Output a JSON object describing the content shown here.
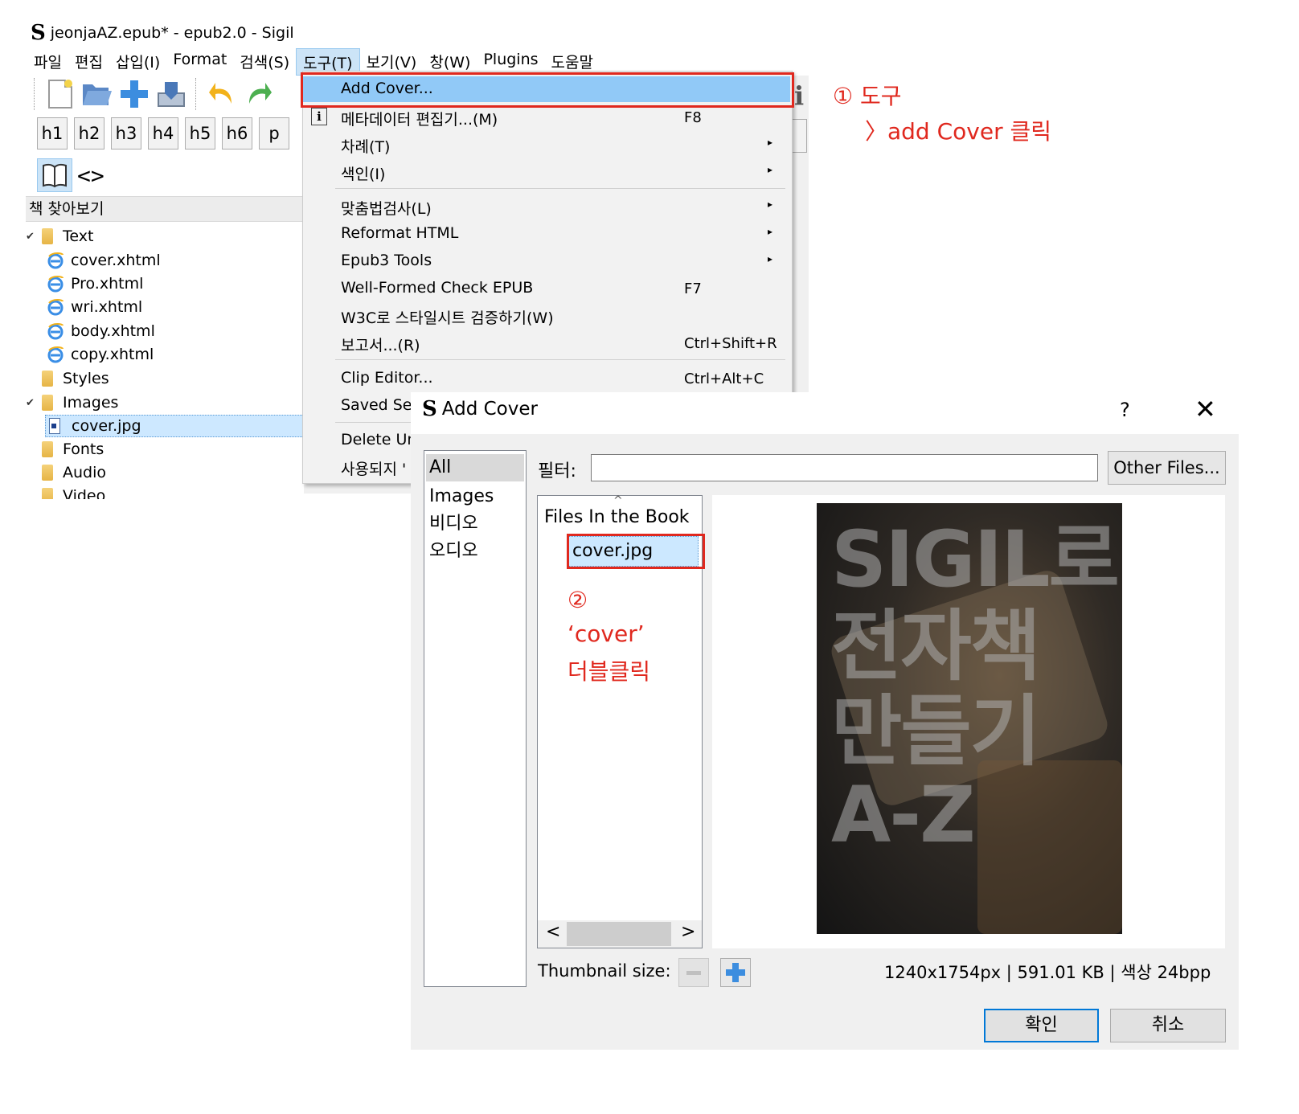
{
  "window": {
    "title": "jeonjaAZ.epub* - epub2.0 - Sigil",
    "logo": "S",
    "logo_icon": "sigil-logo-icon"
  },
  "menubar": [
    "파일",
    "편집",
    "삽입(I)",
    "Format",
    "검색(S)",
    "도구(T)",
    "보기(V)",
    "창(W)",
    "Plugins",
    "도움말"
  ],
  "toolbar": {
    "icons": [
      "new-file-icon",
      "open-folder-icon",
      "add-file-icon",
      "save-icon",
      "undo-icon",
      "redo-icon"
    ],
    "headings": [
      "h1",
      "h2",
      "h3",
      "h4",
      "h5",
      "h6",
      "p"
    ],
    "code_view": "<>"
  },
  "book_browser": {
    "title": "책 찾아보기",
    "items": [
      {
        "label": "Text",
        "type": "folder",
        "expanded": true
      },
      {
        "label": "cover.xhtml",
        "type": "xhtml"
      },
      {
        "label": "Pro.xhtml",
        "type": "xhtml"
      },
      {
        "label": "wri.xhtml",
        "type": "xhtml"
      },
      {
        "label": "body.xhtml",
        "type": "xhtml"
      },
      {
        "label": "copy.xhtml",
        "type": "xhtml"
      },
      {
        "label": "Styles",
        "type": "folder"
      },
      {
        "label": "Images",
        "type": "folder",
        "expanded": true
      },
      {
        "label": "cover.jpg",
        "type": "image",
        "selected": true
      },
      {
        "label": "Fonts",
        "type": "folder"
      },
      {
        "label": "Audio",
        "type": "folder"
      },
      {
        "label": "Video",
        "type": "folder"
      }
    ]
  },
  "tools_menu": {
    "items": [
      {
        "label": "Add Cover...",
        "shortcut": "",
        "submenu": false,
        "highlighted": true
      },
      {
        "label": "메타데이터 편집기...(M)",
        "shortcut": "F8",
        "submenu": false,
        "icon": "info-icon"
      },
      {
        "label": "차례(T)",
        "shortcut": "",
        "submenu": true
      },
      {
        "label": "색인(I)",
        "shortcut": "",
        "submenu": true
      },
      {
        "label": "맞춤법검사(L)",
        "shortcut": "",
        "submenu": true
      },
      {
        "label": "Reformat HTML",
        "shortcut": "",
        "submenu": true
      },
      {
        "label": "Epub3 Tools",
        "shortcut": "",
        "submenu": true
      },
      {
        "label": "Well-Formed Check EPUB",
        "shortcut": "F7",
        "submenu": false
      },
      {
        "label": "W3C로 스타일시트 검증하기(W)",
        "shortcut": "",
        "submenu": false
      },
      {
        "label": "보고서...(R)",
        "shortcut": "Ctrl+Shift+R",
        "submenu": false
      },
      {
        "label": "Clip Editor...",
        "shortcut": "Ctrl+Alt+C",
        "submenu": false
      },
      {
        "label": "Saved Sea",
        "shortcut": "",
        "submenu": false
      },
      {
        "label": "Delete Un",
        "shortcut": "",
        "submenu": false
      },
      {
        "label": "사용되지 '",
        "shortcut": "",
        "submenu": false
      }
    ],
    "submenu_glyph": "▸"
  },
  "annotations": {
    "step1_line1": "① 도구",
    "step1_line2": "〉add Cover 클릭",
    "step2_num": "②",
    "step2_line1": "‘cover’",
    "step2_line2": "더블클릭",
    "color": "#e0281e"
  },
  "dialog": {
    "title": "Add Cover",
    "help": "?",
    "close": "✕",
    "categories": [
      "All",
      "Images",
      "비디오",
      "오디오"
    ],
    "selected_category": "All",
    "filter_label": "필터:",
    "filter_value": "",
    "other_files_button": "Other Files...",
    "files_header": "Files In the Book",
    "sort_indicator": "^",
    "files": [
      "cover.jpg"
    ],
    "scroll_left": "<",
    "scroll_right": ">",
    "preview_text": [
      "SIGIL로",
      "전자책",
      "만들기",
      "A-Z"
    ],
    "thumbnail_label": "Thumbnail size:",
    "image_info": "1240x1754px | 591.01 KB | 색상 24bpp",
    "ok_button": "확인",
    "cancel_button": "취소"
  },
  "colors": {
    "menu_highlight": "#91c9f7",
    "selection": "#cde8ff",
    "annotation_red": "#e0281e",
    "default_button_border": "#0078d7"
  }
}
